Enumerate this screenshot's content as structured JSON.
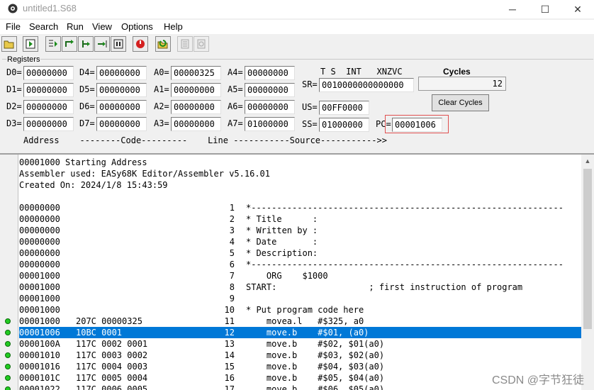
{
  "window": {
    "title": "untitled1.S68",
    "controls": [
      "─",
      "☐",
      "✕"
    ]
  },
  "menu": [
    "File",
    "Search",
    "Run",
    "View",
    "Options",
    "Help"
  ],
  "toolbar": [
    "open-icon",
    "run-icon",
    "step-over-icon",
    "trace-into-icon",
    "run-to-cursor-icon",
    "auto-trace-icon",
    "pause-icon",
    "reset-icon",
    "reload-icon",
    "log-icon",
    "log-disabled-icon"
  ],
  "registers": {
    "group_label": "Registers",
    "D0": "00000000",
    "D1": "00000000",
    "D2": "00000000",
    "D3": "00000000",
    "D4": "00000000",
    "D5": "00000000",
    "D6": "00000000",
    "D7": "00000000",
    "A0": "00000325",
    "A1": "00000000",
    "A2": "00000000",
    "A3": "00000000",
    "A4": "00000000",
    "A5": "00000000",
    "A6": "00000000",
    "A7": "01000000",
    "SR": "0010000000000000",
    "US": "00FF0000",
    "SS": "01000000",
    "PC": "00001006",
    "sr_flags_header": "T S  INT   XNZVC",
    "cycles_label": "Cycles",
    "cycles": "12",
    "clear_cycles": "Clear Cycles"
  },
  "column_header": "Address    --------Code---------    Line -----------Source----------->>",
  "listing": [
    {
      "text": "00001000 Starting Address"
    },
    {
      "text": "Assembler used: EASy68K Editor/Assembler v5.16.01"
    },
    {
      "text": "Created On: 2024/1/8 15:43:59"
    },
    {
      "text": ""
    },
    {
      "addr": "00000000",
      "code": "",
      "line": "1",
      "src": "*-------------------------------------------------------------"
    },
    {
      "addr": "00000000",
      "code": "",
      "line": "2",
      "src": "* Title      :"
    },
    {
      "addr": "00000000",
      "code": "",
      "line": "3",
      "src": "* Written by :"
    },
    {
      "addr": "00000000",
      "code": "",
      "line": "4",
      "src": "* Date       :"
    },
    {
      "addr": "00000000",
      "code": "",
      "line": "5",
      "src": "* Description:"
    },
    {
      "addr": "00000000",
      "code": "",
      "line": "6",
      "src": "*-------------------------------------------------------------"
    },
    {
      "addr": "00001000",
      "code": "",
      "line": "7",
      "src": "    ORG    $1000"
    },
    {
      "addr": "00001000",
      "code": "",
      "line": "8",
      "src": "START:                  ; first instruction of program"
    },
    {
      "addr": "00001000",
      "code": "",
      "line": "9",
      "src": ""
    },
    {
      "addr": "00001000",
      "code": "",
      "line": "10",
      "src": "* Put program code here"
    },
    {
      "addr": "00001000",
      "code": "207C 00000325",
      "line": "11",
      "src": "    movea.l   #$325, a0",
      "bp": true
    },
    {
      "addr": "00001006",
      "code": "10BC 0001",
      "line": "12",
      "src": "    move.b    #$01, (a0)",
      "bp": true,
      "current": true
    },
    {
      "addr": "0000100A",
      "code": "117C 0002 0001",
      "line": "13",
      "src": "    move.b    #$02, $01(a0)",
      "bp": true
    },
    {
      "addr": "00001010",
      "code": "117C 0003 0002",
      "line": "14",
      "src": "    move.b    #$03, $02(a0)",
      "bp": true
    },
    {
      "addr": "00001016",
      "code": "117C 0004 0003",
      "line": "15",
      "src": "    move.b    #$04, $03(a0)",
      "bp": true
    },
    {
      "addr": "0000101C",
      "code": "117C 0005 0004",
      "line": "16",
      "src": "    move.b    #$05, $04(a0)",
      "bp": true
    },
    {
      "addr": "00001022",
      "code": "117C 0006 0005",
      "line": "17",
      "src": "    move.b    #$06, $05(a0)",
      "bp": true
    }
  ],
  "watermark": "CSDN @字节狂徒"
}
